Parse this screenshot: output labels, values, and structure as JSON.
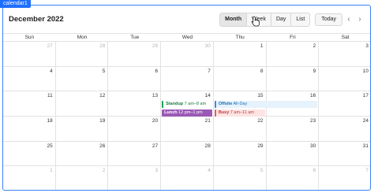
{
  "frame_label": "calendar1",
  "header": {
    "title": "December 2022",
    "views": [
      "Month",
      "Week",
      "Day",
      "List"
    ],
    "active_view": "Month",
    "today_label": "Today",
    "prev_icon": "chevron-left-icon",
    "next_icon": "chevron-right-icon"
  },
  "weekdays": [
    "Sun",
    "Mon",
    "Tue",
    "Wed",
    "Thu",
    "Fri",
    "Sat"
  ],
  "weeks": [
    [
      "27",
      "28",
      "29",
      "30",
      "1",
      "2",
      "3"
    ],
    [
      "4",
      "5",
      "6",
      "7",
      "8",
      "9",
      "10"
    ],
    [
      "11",
      "12",
      "13",
      "14",
      "15",
      "16",
      "17"
    ],
    [
      "18",
      "19",
      "20",
      "21",
      "22",
      "23",
      "24"
    ],
    [
      "25",
      "26",
      "27",
      "28",
      "29",
      "30",
      "31"
    ],
    [
      "1",
      "2",
      "3",
      "4",
      "5",
      "6",
      "7"
    ]
  ],
  "other_month": [
    [
      true,
      true,
      true,
      true,
      false,
      false,
      false
    ],
    [
      false,
      false,
      false,
      false,
      false,
      false,
      false
    ],
    [
      false,
      false,
      false,
      false,
      false,
      false,
      false
    ],
    [
      false,
      false,
      false,
      false,
      false,
      false,
      false
    ],
    [
      false,
      false,
      false,
      false,
      false,
      false,
      false
    ],
    [
      true,
      true,
      true,
      true,
      true,
      true,
      true
    ]
  ],
  "events": {
    "standup": {
      "name": "Standup",
      "time": "7 am–8 am",
      "color": "#22a055"
    },
    "lunch": {
      "name": "Lunch",
      "time": "12 pm–1 pm",
      "color": "#9b59b6"
    },
    "offsite": {
      "name": "Offsite",
      "time": "All-Day",
      "color": "#3a8ed8"
    },
    "busy": {
      "name": "Busy",
      "time": "7 am–11 am",
      "color": "#e06060"
    }
  }
}
